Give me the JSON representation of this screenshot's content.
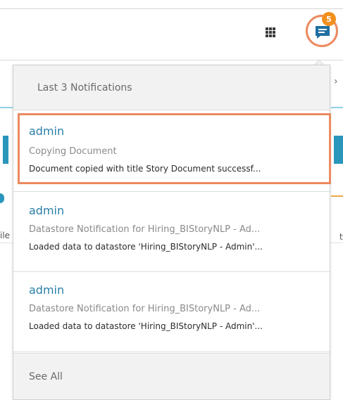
{
  "toolbar": {
    "apps_icon": "apps-grid-icon",
    "chat_icon": "chat-icon",
    "notification_count": "5",
    "colors": {
      "badge": "#f2901e",
      "chat_icon": "#1f6fa0",
      "highlight": "#ec8a60"
    }
  },
  "background": {
    "fragment_left": "ile",
    "fragment_right": "t"
  },
  "notifications_panel": {
    "title": "Last 3 Notifications",
    "items": [
      {
        "user": "admin",
        "subject": "Copying Document",
        "message": "Document copied with title Story Document successf..."
      },
      {
        "user": "admin",
        "subject": "Datastore Notification for Hiring_BIStoryNLP - Ad...",
        "message": "Loaded data to datastore 'Hiring_BIStoryNLP - Admin'..."
      },
      {
        "user": "admin",
        "subject": "Datastore Notification for Hiring_BIStoryNLP - Ad...",
        "message": "Loaded data to datastore 'Hiring_BIStoryNLP - Admin'..."
      }
    ],
    "see_all_label": "See All"
  }
}
